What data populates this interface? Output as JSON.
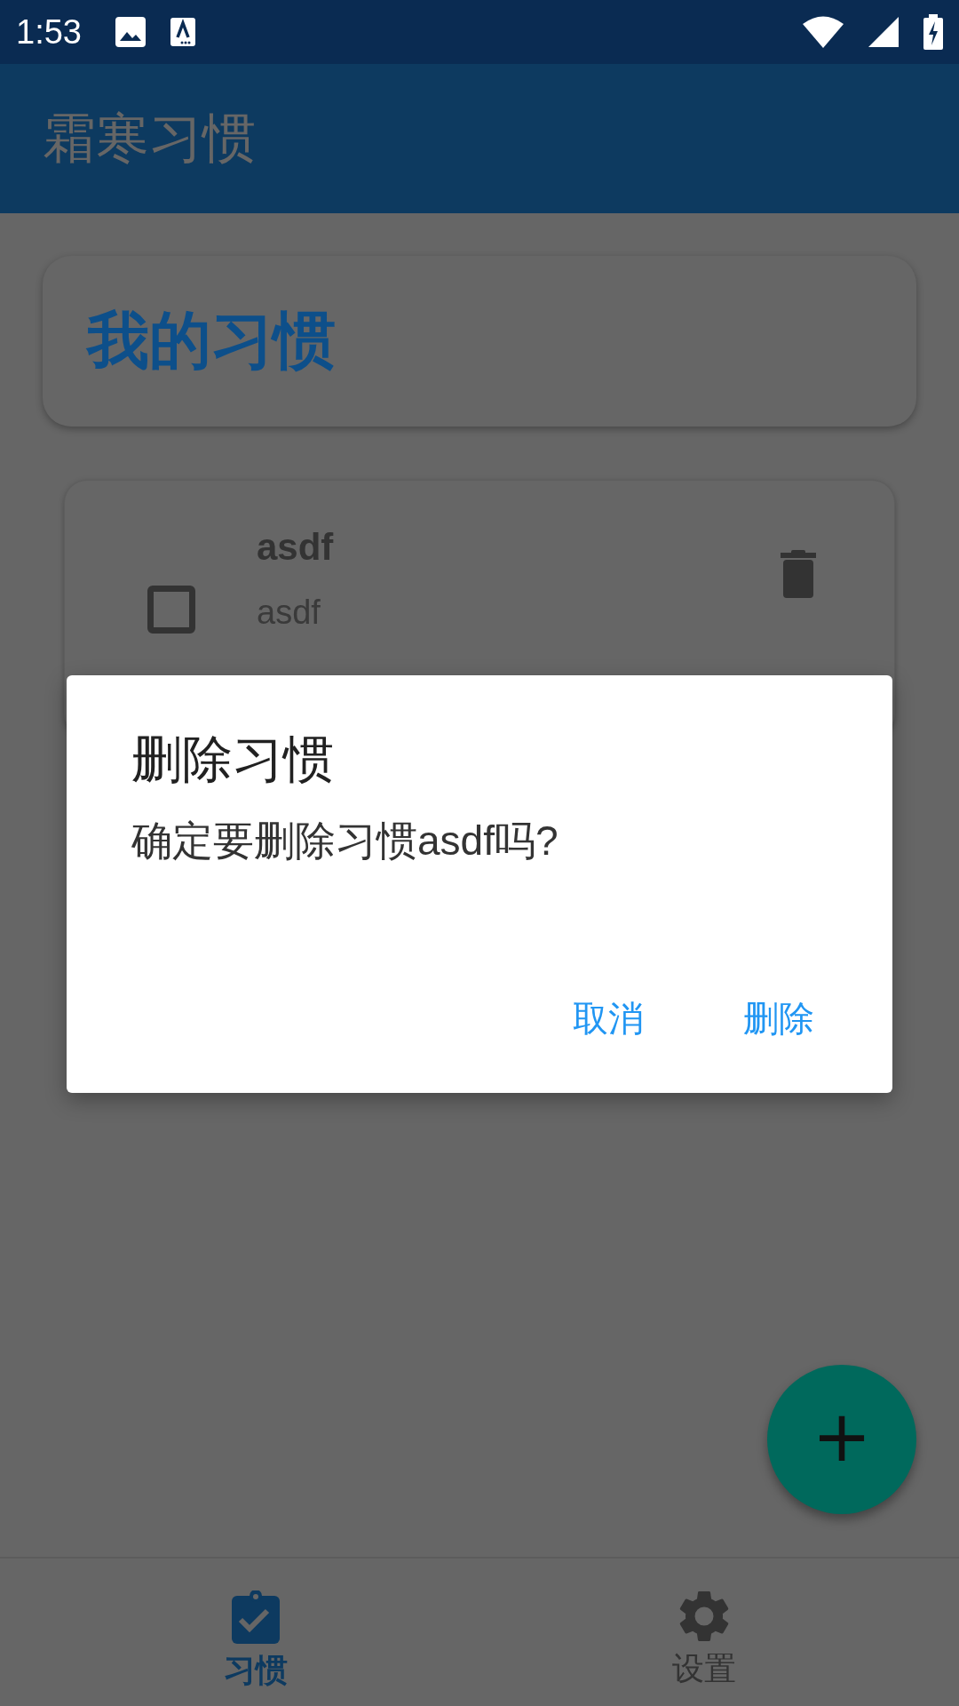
{
  "status_bar": {
    "time": "1:53"
  },
  "app_bar": {
    "title": "霜寒习惯"
  },
  "header_card": {
    "title": "我的习惯"
  },
  "habits": [
    {
      "name": "asdf",
      "description": "asdf",
      "checked": false
    }
  ],
  "dialog": {
    "title": "删除习惯",
    "message": "确定要删除习惯asdf吗?",
    "buttons": [
      "取消",
      "删除"
    ]
  },
  "fab": {
    "label": "+"
  },
  "bottom_nav": [
    {
      "label": "习惯",
      "kind": "habits",
      "selected": true
    },
    {
      "label": "设置",
      "kind": "settings",
      "selected": false
    }
  ]
}
